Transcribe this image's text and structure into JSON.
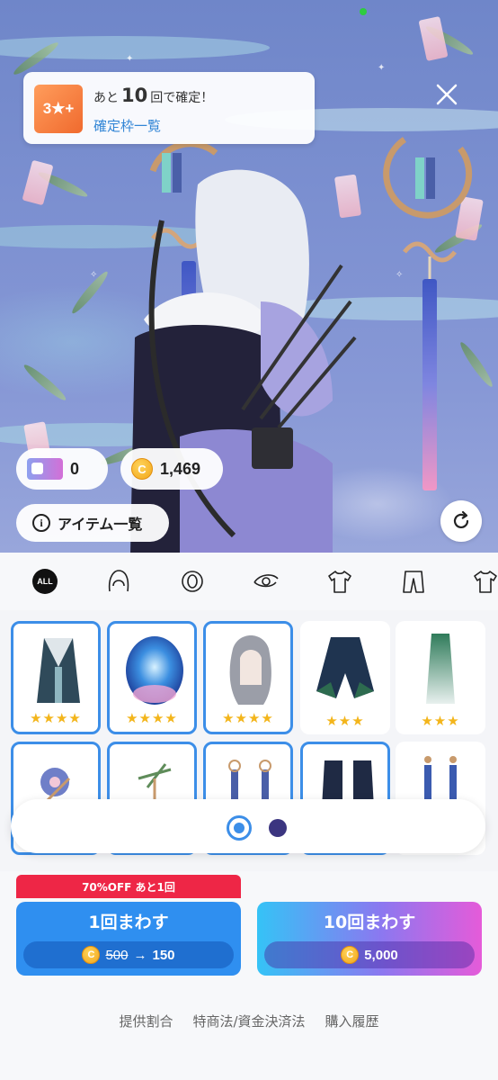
{
  "hint": {
    "badge": "3★+",
    "prefix": "あと",
    "count": "10",
    "suffix": "回で確定！",
    "link": "確定枠一覧"
  },
  "balances": {
    "tickets": "0",
    "coins": "1,469"
  },
  "items_button": "アイテム一覧",
  "categories": {
    "all": "ALL"
  },
  "grid": {
    "row1": [
      {
        "rating": "★★★★",
        "selected": true
      },
      {
        "rating": "★★★★",
        "selected": true
      },
      {
        "rating": "★★★★",
        "selected": true
      },
      {
        "rating": "★★★",
        "selected": false
      },
      {
        "rating": "★★★",
        "selected": false
      }
    ]
  },
  "pager": {
    "pages": 2,
    "current": 1
  },
  "promo": "70%OFF あと1回",
  "single": {
    "label": "1回まわす",
    "coin": "C",
    "old_price": "500",
    "arrow": "→",
    "new_price": "150"
  },
  "ten": {
    "label": "10回まわす",
    "coin": "C",
    "price": "5,000"
  },
  "footer": {
    "rates": "提供割合",
    "law": "特商法/資金決済法",
    "history": "購入履歴"
  },
  "colors": {
    "accent_blue": "#2f8ff0",
    "promo_red": "#ee2646",
    "star_gold": "#f3b51b"
  }
}
